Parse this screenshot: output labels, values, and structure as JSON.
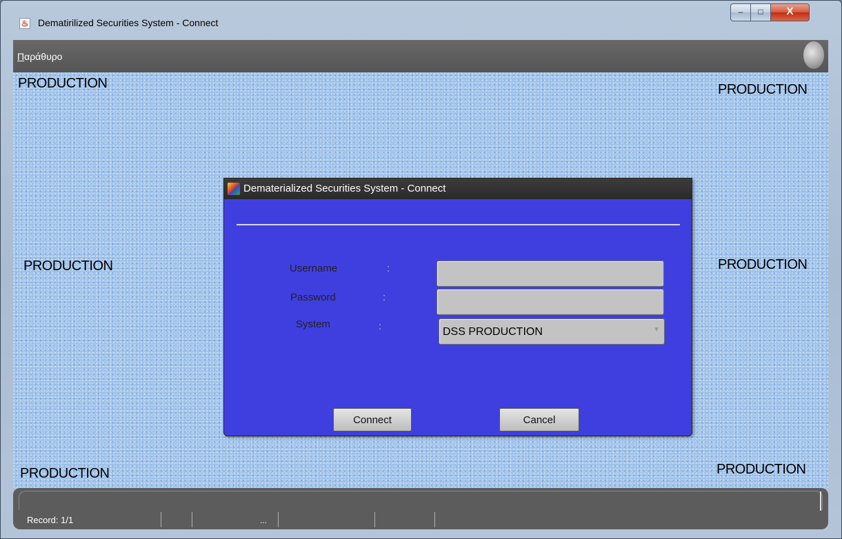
{
  "window": {
    "title": "Dematirilized Securities System - Connect",
    "app_icon": "java-icon",
    "controls": {
      "minimize": "–",
      "maximize": "□",
      "close": "X"
    }
  },
  "menubar": {
    "items": [
      {
        "accesskey": "Π",
        "rest": "αράθυρο"
      }
    ],
    "logo": "oracle-face-logo"
  },
  "background_labels": {
    "top_left": "PRODUCTION",
    "top_right": "PRODUCTION",
    "middle_left": "PRODUCTION",
    "middle_right": "PRODUCTION",
    "bottom_left": "PRODUCTION",
    "bottom_right": "PRODUCTION"
  },
  "dialog": {
    "title": "Dematerialized Securities System - Connect",
    "icon": "forms-app-icon",
    "fields": {
      "username": {
        "label": "Username",
        "colon": ":",
        "value": ""
      },
      "password": {
        "label": "Password",
        "colon": ":",
        "value": ""
      },
      "system": {
        "label": "System",
        "colon": ":",
        "selected": "DSS PRODUCTION"
      }
    },
    "buttons": {
      "connect": "Connect",
      "cancel": "Cancel"
    }
  },
  "statusbar": {
    "record": "Record: 1/1",
    "ellipsis": "..."
  },
  "colors": {
    "dialog_bg": "#3f3fe0",
    "main_bg": "#9dc1ea",
    "menubar_bg": "#5e5e5e",
    "field_bg": "#c3c3c3"
  }
}
